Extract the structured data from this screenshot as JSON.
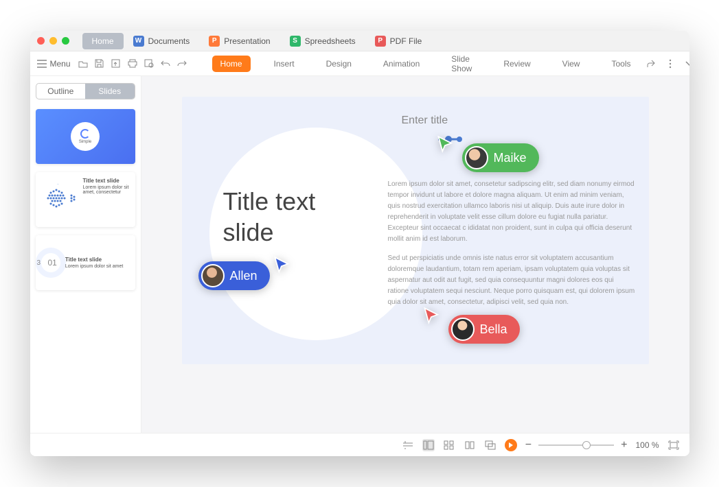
{
  "titlebar": {
    "tabs": [
      {
        "label": "Home",
        "active": true
      },
      {
        "label": "Documents",
        "icon": "W",
        "icon_class": "ic-w"
      },
      {
        "label": "Presentation",
        "icon": "P",
        "icon_class": "ic-p"
      },
      {
        "label": "Spreedsheets",
        "icon": "S",
        "icon_class": "ic-s"
      },
      {
        "label": "PDF File",
        "icon": "P",
        "icon_class": "ic-pdf"
      }
    ]
  },
  "toolbar": {
    "menu_label": "Menu",
    "ribbon": [
      "Home",
      "Insert",
      "Design",
      "Animation",
      "Slide Show",
      "Review",
      "View",
      "Tools"
    ],
    "ribbon_active": "Home"
  },
  "sidebar": {
    "views": {
      "outline": "Outline",
      "slides": "Slides",
      "active": "Slides"
    },
    "thumbs": [
      {
        "label": "Simple"
      },
      {
        "title": "Title text slide",
        "para": "Lorem ipsum dolor sit amet, consectetur"
      },
      {
        "num": "01",
        "title": "Title text slide",
        "para": "Lorem ipsum dolor sit amet"
      }
    ]
  },
  "slide": {
    "title": "Title text\nslide",
    "enter_title": "Enter title",
    "para1": "Lorem ipsum dolor sit amet, consetetur sadipscing elitr, sed diam nonumy eirmod tempor invidunt ut labore et dolore magna aliquam. Ut enim ad minim veniam, quis nostrud exercitation ullamco laboris nisi ut aliquip. Duis aute irure dolor in reprehenderit in voluptate velit esse cillum dolore eu fugiat nulla pariatur. Excepteur sint occaecat c ididatat non proident, sunt in culpa qui officia deserunt mollit anim id est laborum.",
    "para2": "Sed ut perspiciatis unde omnis iste natus error sit voluptatem accusantium doloremque laudantium, totam rem aperiam, ipsam voluptatem quia voluptas sit aspernatur aut odit aut fugit, sed quia consequuntur magni dolores eos qui ratione voluptatem sequi nesciunt. Neque porro quisquam est, qui dolorem ipsum quia dolor sit amet, consectetur, adipisci velit, sed quia non."
  },
  "collaborators": [
    {
      "name": "Maike",
      "color": "green"
    },
    {
      "name": "Allen",
      "color": "blue"
    },
    {
      "name": "Bella",
      "color": "red"
    }
  ],
  "statusbar": {
    "zoom": "100 %"
  }
}
